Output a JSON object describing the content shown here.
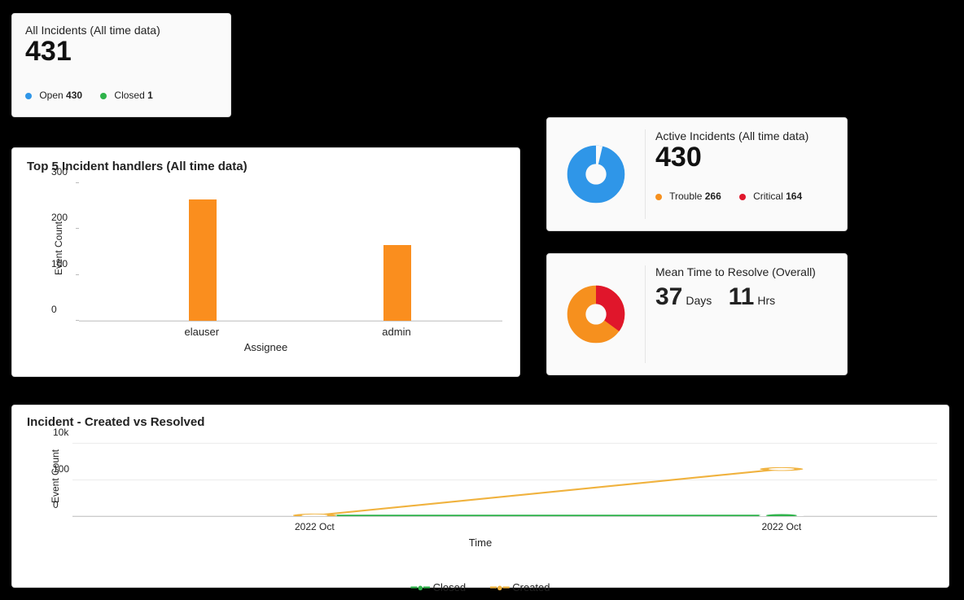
{
  "all_incidents": {
    "title": "All Incidents (All time data)",
    "value": "431",
    "legend": [
      {
        "color": "#2f96e8",
        "label": "Open",
        "value": "430"
      },
      {
        "color": "#2eb34a",
        "label": "Closed",
        "value": "1"
      }
    ]
  },
  "handlers": {
    "title": "Top 5 Incident handlers (All time data)",
    "ylabel": "Event Count",
    "xlabel": "Assignee"
  },
  "active_incidents": {
    "title": "Active Incidents (All time data)",
    "value": "430",
    "donut": [
      {
        "color": "#2f96e8",
        "share": 1.0
      }
    ],
    "legend": [
      {
        "color": "#f6901e",
        "label": "Trouble",
        "value": "266"
      },
      {
        "color": "#e0162b",
        "label": "Critical",
        "value": "164"
      }
    ]
  },
  "mttr": {
    "title": "Mean Time to Resolve (Overall)",
    "days": "37",
    "days_unit": "Days",
    "hrs": "11",
    "hrs_unit": "Hrs",
    "donut": [
      {
        "color": "#e0162b",
        "share": 0.35
      },
      {
        "color": "#f6901e",
        "share": 0.65
      }
    ]
  },
  "created_vs_resolved": {
    "title": "Incident - Created vs Resolved",
    "ylabel": "Event Count",
    "xlabel": "Time",
    "legend": [
      {
        "color": "#2eb34a",
        "label": "Closed"
      },
      {
        "color": "#f0b23e",
        "label": "Created"
      }
    ]
  },
  "chart_data": [
    {
      "id": "top5_handlers",
      "type": "bar",
      "title": "Top 5 Incident handlers (All time data)",
      "xlabel": "Assignee",
      "ylabel": "Event Count",
      "categories": [
        "elauser",
        "admin"
      ],
      "values": [
        265,
        165
      ],
      "ylim": [
        0,
        300
      ],
      "yticks": [
        0,
        100,
        200,
        300
      ],
      "series_color": "#fa8e1e"
    },
    {
      "id": "active_incidents_donut",
      "type": "pie",
      "title": "Active Incidents (All time data)",
      "series": [
        {
          "name": "Active",
          "value": 430,
          "color": "#2f96e8"
        }
      ],
      "breakdown": [
        {
          "name": "Trouble",
          "value": 266,
          "color": "#f6901e"
        },
        {
          "name": "Critical",
          "value": 164,
          "color": "#e0162b"
        }
      ]
    },
    {
      "id": "mttr_donut",
      "type": "pie",
      "title": "Mean Time to Resolve (Overall)",
      "series": [
        {
          "name": "segment_a",
          "value": 0.35,
          "color": "#e0162b"
        },
        {
          "name": "segment_b",
          "value": 0.65,
          "color": "#f6901e"
        }
      ],
      "value_text": "37 Days 11 Hrs"
    },
    {
      "id": "created_vs_resolved",
      "type": "line",
      "title": "Incident - Created vs Resolved",
      "xlabel": "Time",
      "ylabel": "Event Count",
      "x": [
        "2022 Oct",
        "2022 Oct"
      ],
      "yticks": [
        0,
        100,
        10000
      ],
      "ytick_labels": [
        "0",
        "100",
        "10k"
      ],
      "series": [
        {
          "name": "Closed",
          "color": "#2eb34a",
          "values": [
            1,
            1
          ]
        },
        {
          "name": "Created",
          "color": "#f0b23e",
          "values": [
            1,
            200
          ]
        }
      ]
    }
  ]
}
